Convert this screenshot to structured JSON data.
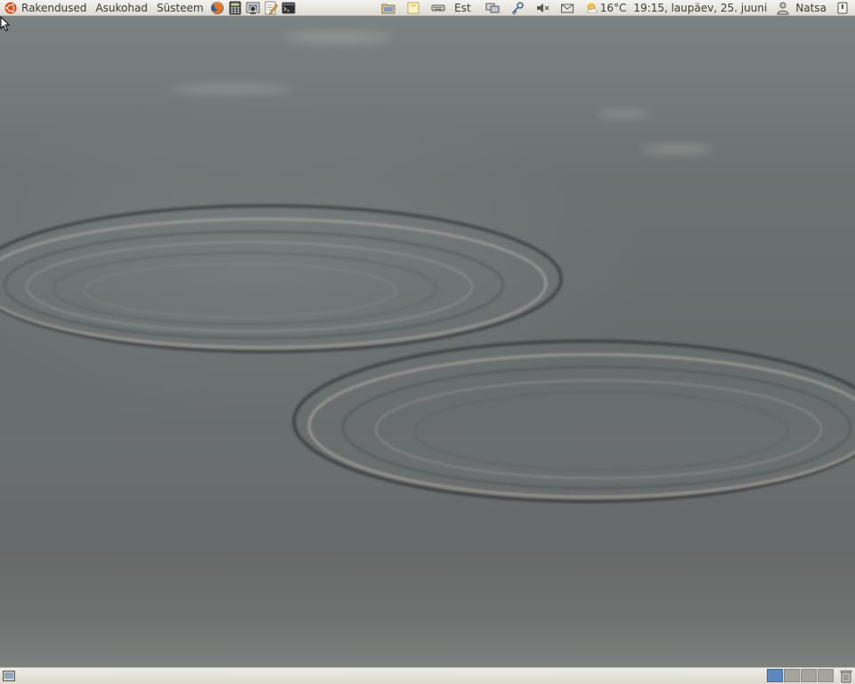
{
  "top_panel": {
    "menus": [
      "Rakendused",
      "Asukohad",
      "Süsteem"
    ],
    "launchers": [
      "firefox-icon",
      "calculator-icon",
      "screenshot-icon",
      "text-editor-icon",
      "terminal-icon"
    ],
    "tray": {
      "keyboard_layout": "Est",
      "weather_temp": "16°C",
      "clock": "19:15, laupäev, 25. juuni",
      "user": "Natsa"
    }
  },
  "bottom_panel": {
    "workspace_count": 4,
    "active_workspace": 1
  },
  "colors": {
    "panel": "#e7e4dd",
    "workspace_active": "#5d87c2",
    "ubuntu_orange": "#dd4814"
  }
}
